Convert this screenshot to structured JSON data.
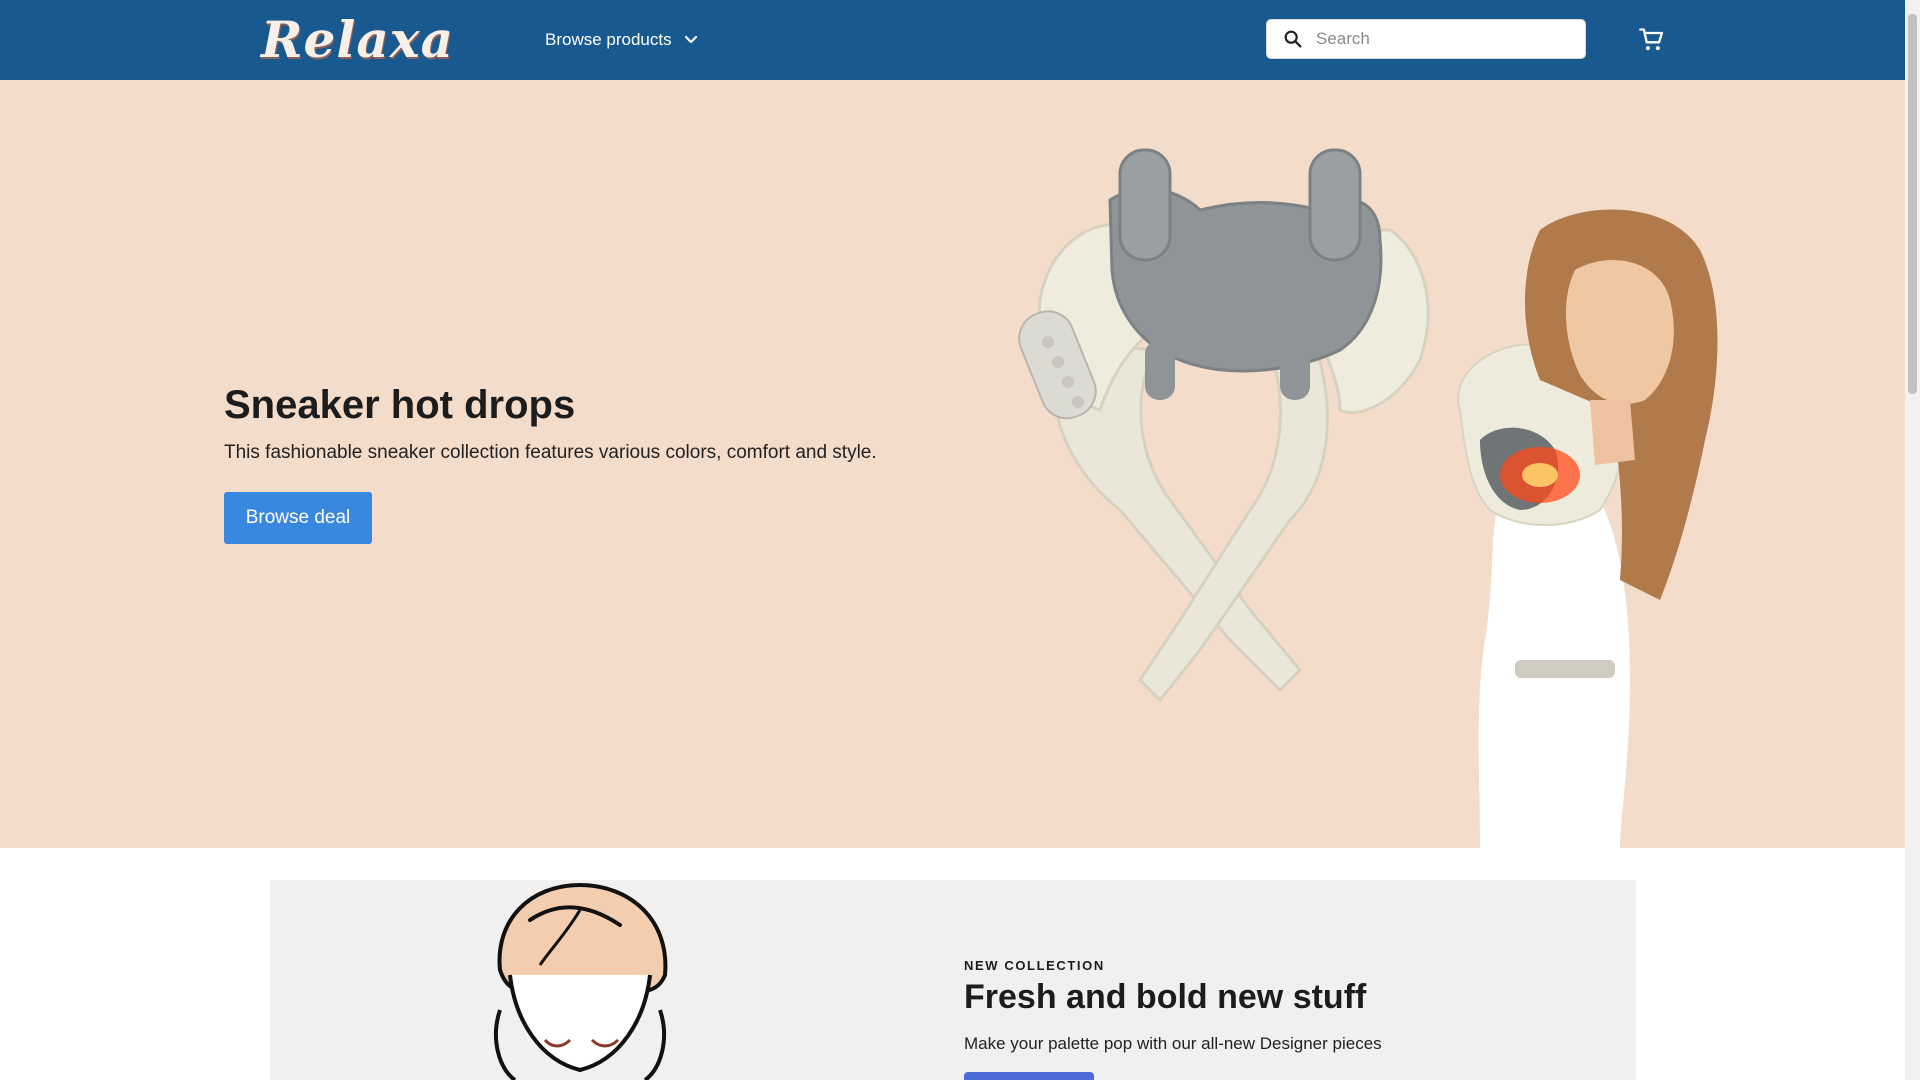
{
  "header": {
    "logo_text": "Relaxa",
    "nav_label": "Browse products",
    "search_placeholder": "Search"
  },
  "hero": {
    "title": "Sneaker hot drops",
    "subtitle": "This fashionable sneaker collection features various colors, comfort and style.",
    "button_label": "Browse deal"
  },
  "collection": {
    "eyebrow": "NEW COLLECTION",
    "title": "Fresh and bold new stuff",
    "text": "Make your palette pop with our all-new Designer pieces"
  },
  "colors": {
    "header_bg": "#185a90",
    "hero_bg": "#f4dccb",
    "primary_button": "#3888e0",
    "collection_bg": "#f1f0ee",
    "collection_button": "#4f6bd8"
  },
  "icons": {
    "search": "search-icon",
    "nav_dropdown": "chevron-down-icon",
    "cart": "shopping-cart-icon"
  }
}
